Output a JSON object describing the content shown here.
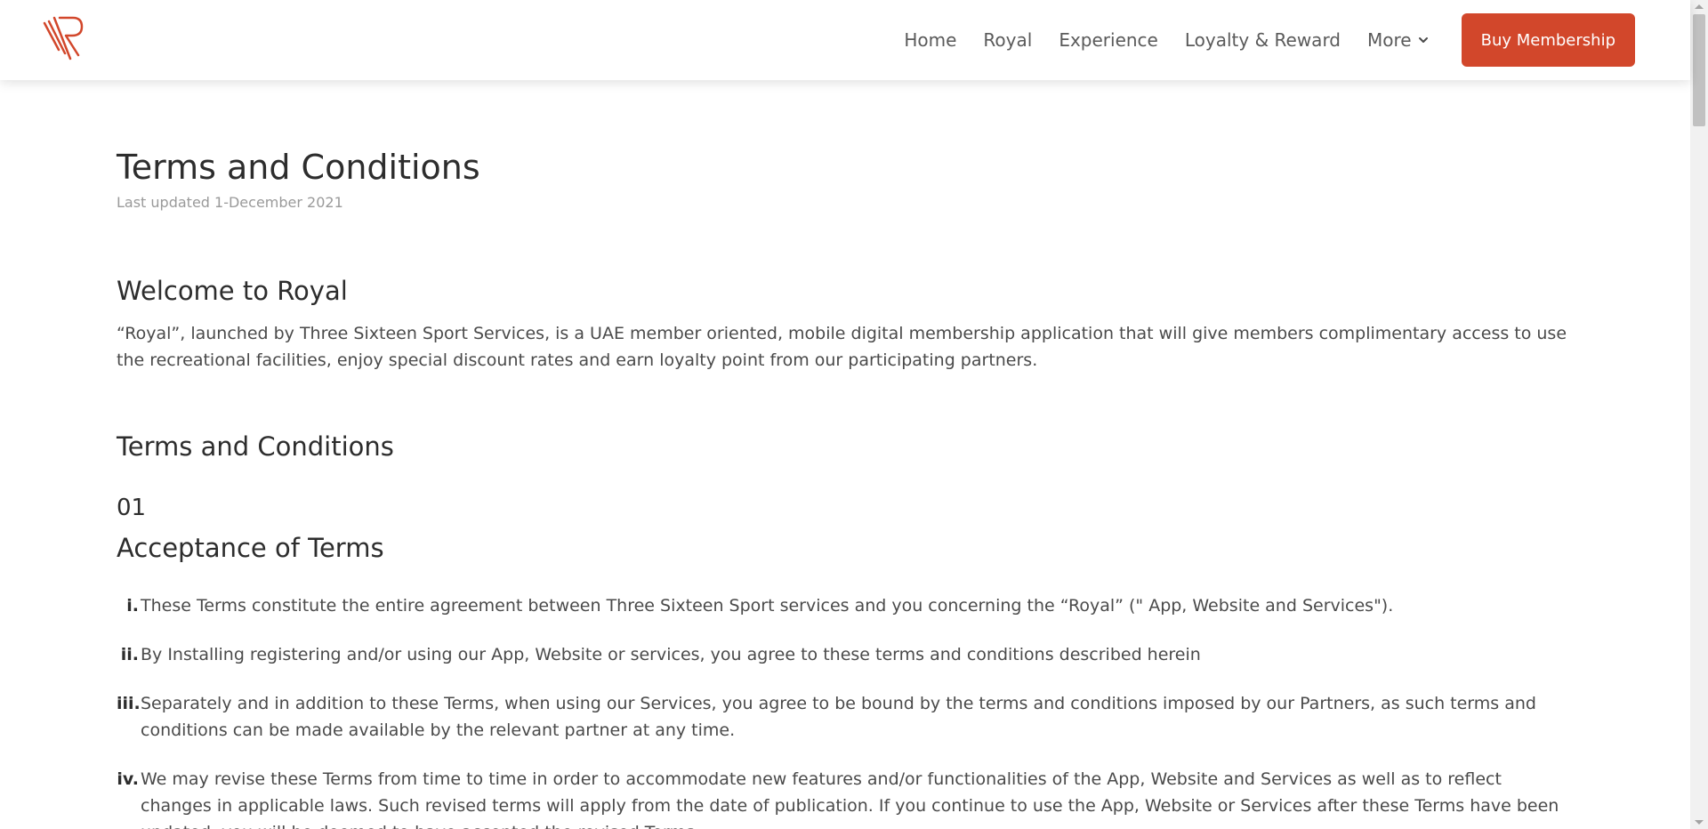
{
  "header": {
    "logo_icon": "royal-logo-icon",
    "nav": [
      {
        "label": "Home"
      },
      {
        "label": "Royal"
      },
      {
        "label": "Experience"
      },
      {
        "label": "Loyalty & Reward"
      },
      {
        "label": "More",
        "icon": "chevron-down-icon"
      }
    ],
    "cta_label": "Buy Membership",
    "accent_color": "#d2472b"
  },
  "page": {
    "title": "Terms and Conditions",
    "last_updated": "Last updated 1-December 2021",
    "welcome_heading": "Welcome to Royal",
    "welcome_text": "“Royal”, launched by Three Sixteen Sport Services, is a UAE member oriented, mobile digital membership application that will give members complimentary access to use the recreational facilities, enjoy special discount rates and earn loyalty point from our participating partners.",
    "terms_heading": "Terms and Conditions",
    "section": {
      "number": "01",
      "heading": "Acceptance of Terms",
      "items": [
        {
          "num": "i.",
          "text": "These Terms constitute the entire agreement between Three Sixteen Sport services and you concerning the “Royal” (\" App, Website and Services\")."
        },
        {
          "num": "ii.",
          "text": "By Installing registering and/or using our App, Website or services, you agree to these terms and conditions described herein"
        },
        {
          "num": "iii.",
          "text": "Separately and in addition to these Terms, when using our Services, you agree to be bound by the terms and conditions imposed by our Partners, as such terms and conditions can be made available by the relevant partner at any time."
        },
        {
          "num": "iv.",
          "text": "We may revise these Terms from time to time in order to accommodate new features and/or functionalities of the App, Website and Services as well as to reflect changes in applicable laws. Such revised terms will apply from the date of publication. If you continue to use the App, Website or Services after these Terms have been updated, you will be deemed to have accepted the revised Terms."
        }
      ]
    }
  }
}
